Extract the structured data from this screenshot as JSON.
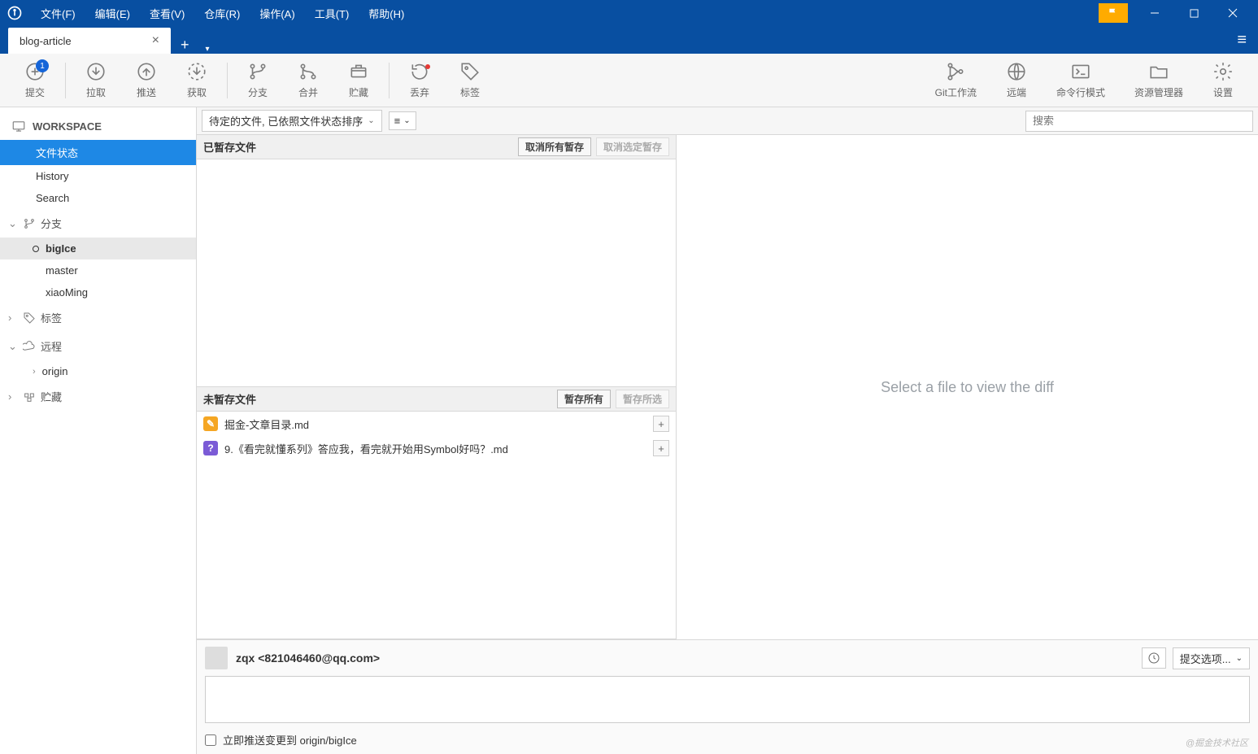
{
  "menubar": {
    "items": [
      "文件(F)",
      "编辑(E)",
      "查看(V)",
      "仓库(R)",
      "操作(A)",
      "工具(T)",
      "帮助(H)"
    ]
  },
  "tab": {
    "title": "blog-article"
  },
  "toolbar": {
    "commit": "提交",
    "pull": "拉取",
    "push": "推送",
    "fetch": "获取",
    "branch": "分支",
    "merge": "合并",
    "stash": "贮藏",
    "discard": "丢弃",
    "tag": "标签",
    "gitflow": "Git工作流",
    "remote": "远端",
    "terminal": "命令行模式",
    "explorer": "资源管理器",
    "settings": "设置",
    "commit_badge": "1"
  },
  "sidebar": {
    "workspace": "WORKSPACE",
    "ws_items": [
      "文件状态",
      "History",
      "Search"
    ],
    "branches_label": "分支",
    "branches": [
      "bigIce",
      "master",
      "xiaoMing"
    ],
    "tags_label": "标签",
    "remotes_label": "远程",
    "remotes": [
      "origin"
    ],
    "stash_label": "贮藏"
  },
  "filter": {
    "sort": "待定的文件, 已依照文件状态排序",
    "search_ph": "搜索"
  },
  "staged": {
    "title": "已暂存文件",
    "unstage_all": "取消所有暂存",
    "unstage_sel": "取消选定暂存"
  },
  "unstaged": {
    "title": "未暂存文件",
    "stage_all": "暂存所有",
    "stage_sel": "暂存所选",
    "files": [
      {
        "icon": "mod",
        "name": "掘金-文章目录.md"
      },
      {
        "icon": "unk",
        "name": "9.《看完就懂系列》答应我，看完就开始用Symbol好吗？.md"
      }
    ]
  },
  "diff": {
    "placeholder": "Select a file to view the diff"
  },
  "commit": {
    "author": "zqx <821046460@qq.com>",
    "options": "提交选项...",
    "push_label": "立即推送变更到 origin/bigIce"
  },
  "watermark": "@掘金技术社区"
}
